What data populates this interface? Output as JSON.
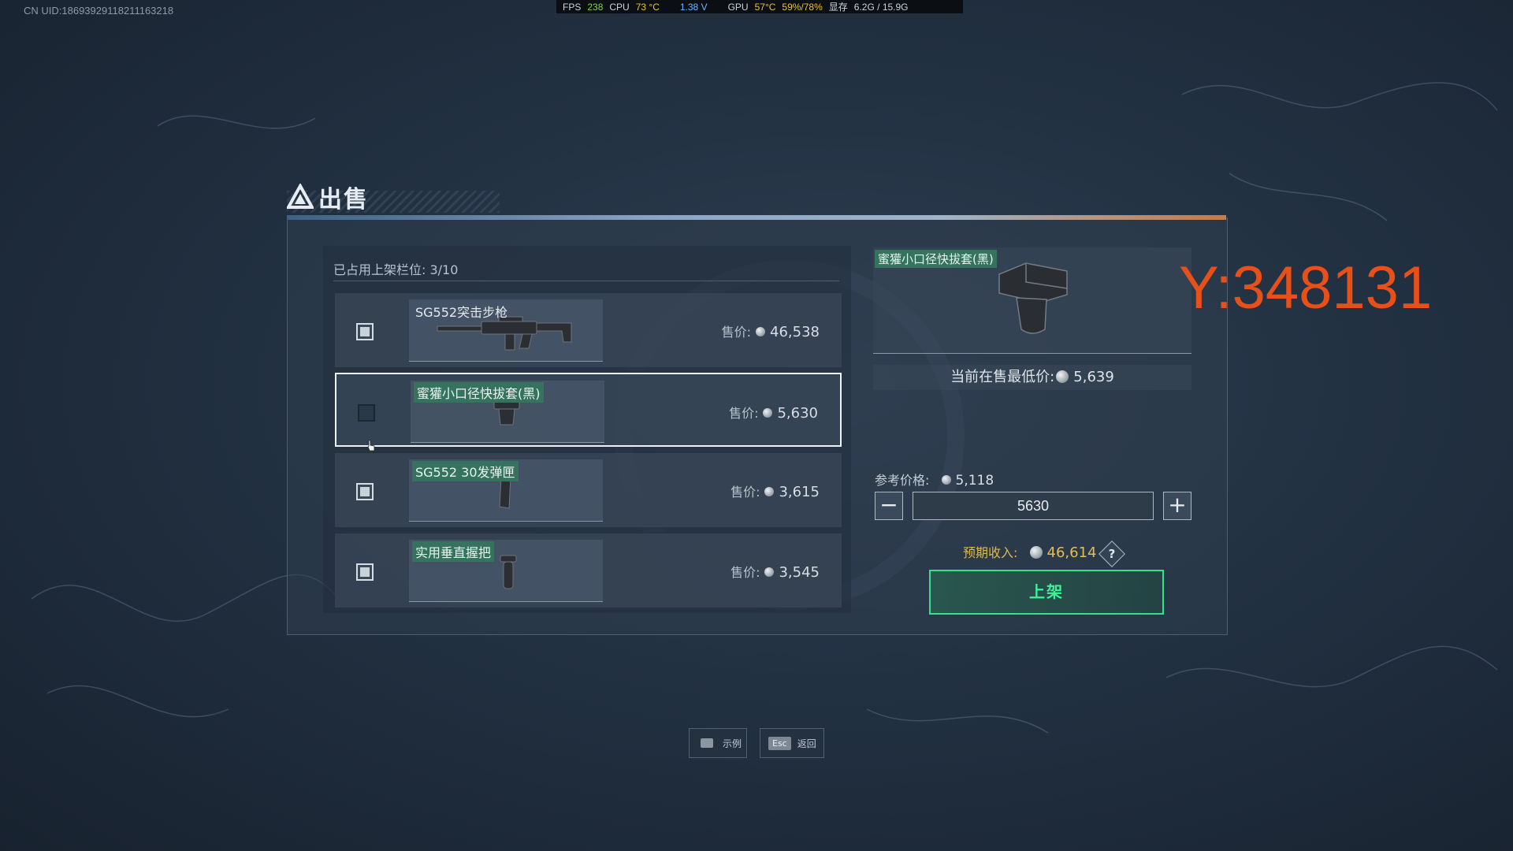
{
  "overlay": {
    "uid": "CN UID:18693929118211163218",
    "perf": {
      "fps_label": "FPS",
      "fps": "238",
      "cpu_label": "CPU",
      "cpu_temp": "73 °C",
      "cpu_volt": "1.38 V",
      "gpu_label": "GPU",
      "gpu_temp": "57°C",
      "gpu_load": "59%/78%",
      "vram_label": "显存",
      "vram": "6.2G / 15.9G"
    },
    "y_coord": "Y:348131"
  },
  "dialog": {
    "title": "出售",
    "slots_text": "已占用上架栏位: 3/10",
    "price_label": "售价:",
    "items": [
      {
        "name": "SG552突击步枪",
        "price": "46,538",
        "checked": true,
        "selected": false,
        "tagged": false,
        "icon": "rifle"
      },
      {
        "name": "蜜獾小口径快拔套(黑)",
        "price": "5,630",
        "checked": false,
        "selected": true,
        "tagged": true,
        "icon": "muzzle"
      },
      {
        "name": "SG552 30发弹匣",
        "price": "3,615",
        "checked": true,
        "selected": false,
        "tagged": true,
        "icon": "magazine"
      },
      {
        "name": "实用垂直握把",
        "price": "3,545",
        "checked": true,
        "selected": false,
        "tagged": true,
        "icon": "grip"
      }
    ],
    "detail": {
      "name": "蜜獾小口径快拔套(黑)",
      "lowest_label": "当前在售最低价:",
      "lowest_value": "5,639",
      "ref_label": "参考价格:",
      "ref_value": "5,118",
      "quantity": "5630",
      "minus": "−",
      "plus": "+",
      "income_label": "预期收入:",
      "income_value": "46,614",
      "help": "?",
      "list_button": "上架"
    }
  },
  "footer": {
    "example_label": "示例",
    "back_key": "Esc",
    "back_label": "返回"
  },
  "colors": {
    "accent_green": "#38e08a",
    "tag_green": "#35735e",
    "coord_orange": "#e8501a",
    "income_gold": "#e0b84a"
  }
}
